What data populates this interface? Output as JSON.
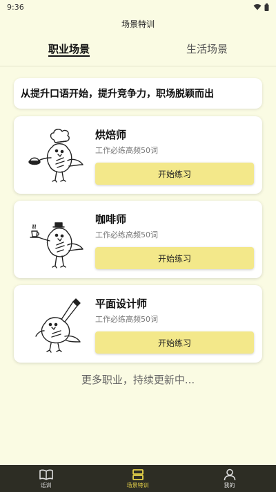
{
  "status_bar": {
    "time": "9:36",
    "icons": [
      "wifi-icon",
      "battery-icon"
    ]
  },
  "page": {
    "title": "场景特训"
  },
  "tabs": [
    {
      "label": "职业场景",
      "active": true
    },
    {
      "label": "生活场景",
      "active": false
    }
  ],
  "slogan": "从提升口语开始，提升竞争力，职场脱颖而出",
  "jobs": [
    {
      "title": "烘焙师",
      "subtitle": "工作必练高频50词",
      "button": "开始练习",
      "illustration": "baker-bird-icon"
    },
    {
      "title": "咖啡师",
      "subtitle": "工作必练高频50词",
      "button": "开始练习",
      "illustration": "barista-bird-icon"
    },
    {
      "title": "平面设计师",
      "subtitle": "工作必练高频50词",
      "button": "开始练习",
      "illustration": "designer-bird-icon"
    }
  ],
  "more_text": "更多职业，持续更新中...",
  "bottom_nav": [
    {
      "label": "话训",
      "icon": "book-icon",
      "active": false
    },
    {
      "label": "场景特训",
      "icon": "scene-icon",
      "active": true
    },
    {
      "label": "我的",
      "icon": "person-icon",
      "active": false
    }
  ],
  "colors": {
    "background": "#fafbe3",
    "button": "#f3e88a",
    "nav_bg": "#2d2d24",
    "nav_active": "#e8d44a"
  }
}
